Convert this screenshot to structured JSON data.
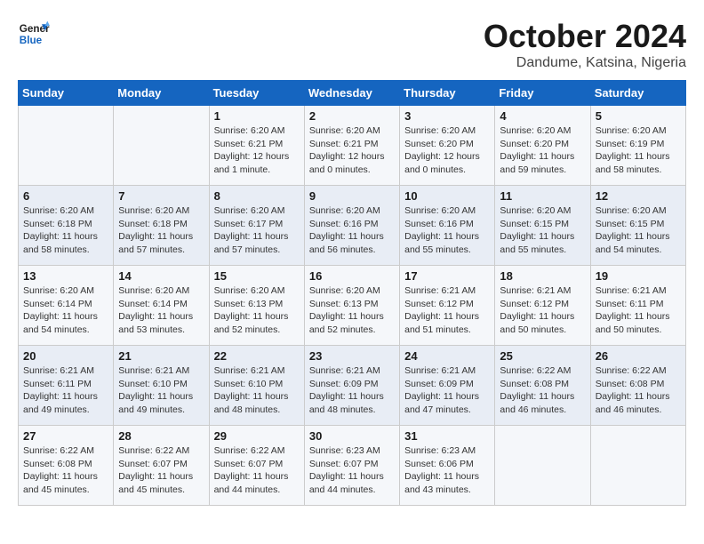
{
  "header": {
    "logo_general": "General",
    "logo_blue": "Blue",
    "month_title": "October 2024",
    "location": "Dandume, Katsina, Nigeria"
  },
  "days_of_week": [
    "Sunday",
    "Monday",
    "Tuesday",
    "Wednesday",
    "Thursday",
    "Friday",
    "Saturday"
  ],
  "weeks": [
    [
      {
        "day": "",
        "content": ""
      },
      {
        "day": "",
        "content": ""
      },
      {
        "day": "1",
        "content": "Sunrise: 6:20 AM\nSunset: 6:21 PM\nDaylight: 12 hours and 1 minute."
      },
      {
        "day": "2",
        "content": "Sunrise: 6:20 AM\nSunset: 6:21 PM\nDaylight: 12 hours and 0 minutes."
      },
      {
        "day": "3",
        "content": "Sunrise: 6:20 AM\nSunset: 6:20 PM\nDaylight: 12 hours and 0 minutes."
      },
      {
        "day": "4",
        "content": "Sunrise: 6:20 AM\nSunset: 6:20 PM\nDaylight: 11 hours and 59 minutes."
      },
      {
        "day": "5",
        "content": "Sunrise: 6:20 AM\nSunset: 6:19 PM\nDaylight: 11 hours and 58 minutes."
      }
    ],
    [
      {
        "day": "6",
        "content": "Sunrise: 6:20 AM\nSunset: 6:18 PM\nDaylight: 11 hours and 58 minutes."
      },
      {
        "day": "7",
        "content": "Sunrise: 6:20 AM\nSunset: 6:18 PM\nDaylight: 11 hours and 57 minutes."
      },
      {
        "day": "8",
        "content": "Sunrise: 6:20 AM\nSunset: 6:17 PM\nDaylight: 11 hours and 57 minutes."
      },
      {
        "day": "9",
        "content": "Sunrise: 6:20 AM\nSunset: 6:16 PM\nDaylight: 11 hours and 56 minutes."
      },
      {
        "day": "10",
        "content": "Sunrise: 6:20 AM\nSunset: 6:16 PM\nDaylight: 11 hours and 55 minutes."
      },
      {
        "day": "11",
        "content": "Sunrise: 6:20 AM\nSunset: 6:15 PM\nDaylight: 11 hours and 55 minutes."
      },
      {
        "day": "12",
        "content": "Sunrise: 6:20 AM\nSunset: 6:15 PM\nDaylight: 11 hours and 54 minutes."
      }
    ],
    [
      {
        "day": "13",
        "content": "Sunrise: 6:20 AM\nSunset: 6:14 PM\nDaylight: 11 hours and 54 minutes."
      },
      {
        "day": "14",
        "content": "Sunrise: 6:20 AM\nSunset: 6:14 PM\nDaylight: 11 hours and 53 minutes."
      },
      {
        "day": "15",
        "content": "Sunrise: 6:20 AM\nSunset: 6:13 PM\nDaylight: 11 hours and 52 minutes."
      },
      {
        "day": "16",
        "content": "Sunrise: 6:20 AM\nSunset: 6:13 PM\nDaylight: 11 hours and 52 minutes."
      },
      {
        "day": "17",
        "content": "Sunrise: 6:21 AM\nSunset: 6:12 PM\nDaylight: 11 hours and 51 minutes."
      },
      {
        "day": "18",
        "content": "Sunrise: 6:21 AM\nSunset: 6:12 PM\nDaylight: 11 hours and 50 minutes."
      },
      {
        "day": "19",
        "content": "Sunrise: 6:21 AM\nSunset: 6:11 PM\nDaylight: 11 hours and 50 minutes."
      }
    ],
    [
      {
        "day": "20",
        "content": "Sunrise: 6:21 AM\nSunset: 6:11 PM\nDaylight: 11 hours and 49 minutes."
      },
      {
        "day": "21",
        "content": "Sunrise: 6:21 AM\nSunset: 6:10 PM\nDaylight: 11 hours and 49 minutes."
      },
      {
        "day": "22",
        "content": "Sunrise: 6:21 AM\nSunset: 6:10 PM\nDaylight: 11 hours and 48 minutes."
      },
      {
        "day": "23",
        "content": "Sunrise: 6:21 AM\nSunset: 6:09 PM\nDaylight: 11 hours and 48 minutes."
      },
      {
        "day": "24",
        "content": "Sunrise: 6:21 AM\nSunset: 6:09 PM\nDaylight: 11 hours and 47 minutes."
      },
      {
        "day": "25",
        "content": "Sunrise: 6:22 AM\nSunset: 6:08 PM\nDaylight: 11 hours and 46 minutes."
      },
      {
        "day": "26",
        "content": "Sunrise: 6:22 AM\nSunset: 6:08 PM\nDaylight: 11 hours and 46 minutes."
      }
    ],
    [
      {
        "day": "27",
        "content": "Sunrise: 6:22 AM\nSunset: 6:08 PM\nDaylight: 11 hours and 45 minutes."
      },
      {
        "day": "28",
        "content": "Sunrise: 6:22 AM\nSunset: 6:07 PM\nDaylight: 11 hours and 45 minutes."
      },
      {
        "day": "29",
        "content": "Sunrise: 6:22 AM\nSunset: 6:07 PM\nDaylight: 11 hours and 44 minutes."
      },
      {
        "day": "30",
        "content": "Sunrise: 6:23 AM\nSunset: 6:07 PM\nDaylight: 11 hours and 44 minutes."
      },
      {
        "day": "31",
        "content": "Sunrise: 6:23 AM\nSunset: 6:06 PM\nDaylight: 11 hours and 43 minutes."
      },
      {
        "day": "",
        "content": ""
      },
      {
        "day": "",
        "content": ""
      }
    ]
  ]
}
